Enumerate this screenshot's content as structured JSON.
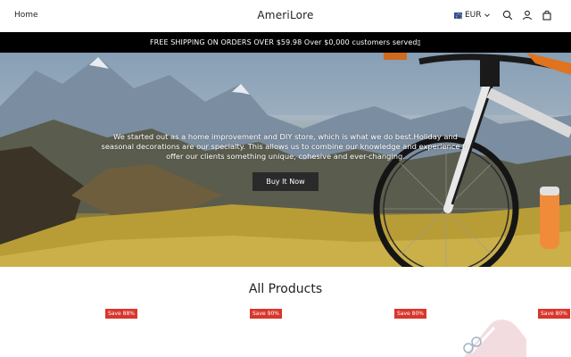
{
  "header": {
    "nav_home": "Home",
    "brand": "AmeriLore",
    "currency": "EUR",
    "icons": [
      "flag-eu-icon",
      "chevron-down-icon",
      "search-icon",
      "account-icon",
      "cart-icon"
    ]
  },
  "announcement": {
    "text": "FREE SHIPPING ON ORDERS OVER $59.98 Over $0,000 customers served▯"
  },
  "hero": {
    "text": "We started out as a home improvement and DIY store, which is what we do best.Holiday and seasonal decorations are our specialty. This allows us to combine our knowledge and experience to offer our clients something unique, cohesive and ever-changing.",
    "button_label": "Buy It Now"
  },
  "products": {
    "title": "All Products",
    "items": [
      {
        "badge": "Save 88%"
      },
      {
        "badge": "Save 90%"
      },
      {
        "badge": "Save 80%"
      },
      {
        "badge": "Save 80%"
      }
    ]
  },
  "colors": {
    "announcement_bg": "#000000",
    "badge_bg": "#d8362d",
    "button_bg": "#2a2a2a"
  }
}
